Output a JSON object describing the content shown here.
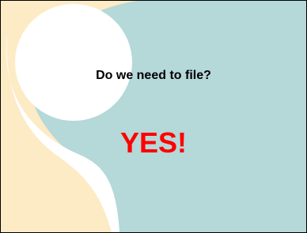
{
  "slide": {
    "question": "Do we need to file?",
    "answer": "YES!"
  },
  "colors": {
    "background_teal": "#b5d8d9",
    "accent_cream": "#fdebc6",
    "swoosh_white": "#ffffff",
    "question_text": "#000000",
    "answer_text": "#ff0000",
    "border": "#000000"
  }
}
